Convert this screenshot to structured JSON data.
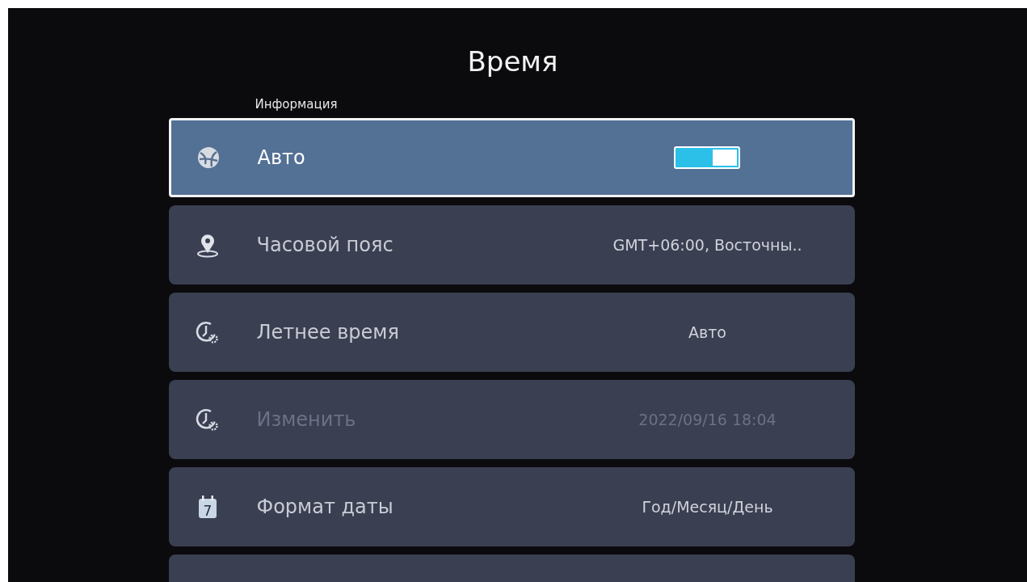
{
  "title": "Время",
  "section": "Информация",
  "items": [
    {
      "kind": "toggle",
      "label": "Авто",
      "selected": true,
      "disabled": false,
      "on": true
    },
    {
      "kind": "value",
      "label": "Часовой пояс",
      "value": "GMT+06:00, Восточны..",
      "selected": false,
      "disabled": false
    },
    {
      "kind": "value",
      "label": "Летнее время",
      "value": "Авто",
      "selected": false,
      "disabled": false
    },
    {
      "kind": "value",
      "label": "Изменить",
      "value": "2022/09/16 18:04",
      "selected": false,
      "disabled": true
    },
    {
      "kind": "value",
      "icon_text": "7",
      "label": "Формат даты",
      "value": "Год/Месяц/День",
      "selected": false,
      "disabled": false
    }
  ]
}
